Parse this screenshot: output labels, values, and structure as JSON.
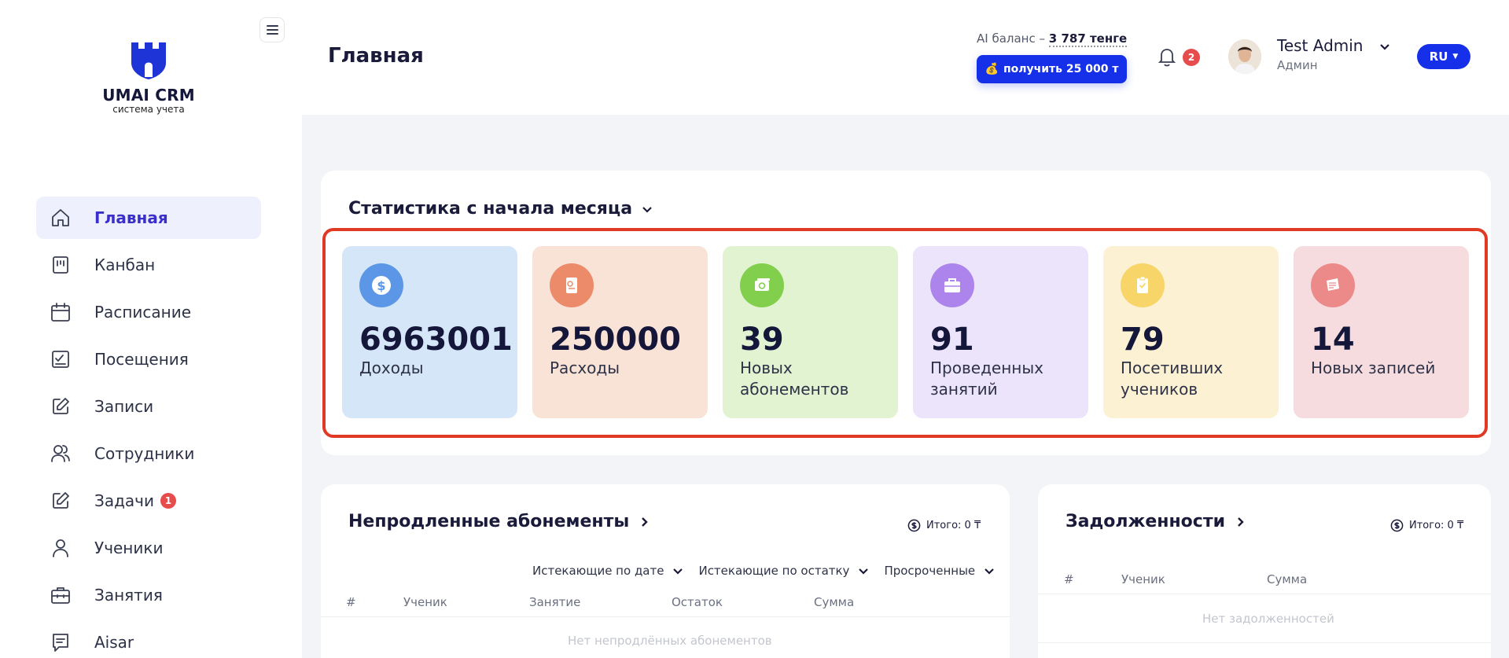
{
  "logo": {
    "name": "UMAI CRM",
    "subtitle": "система учета"
  },
  "sidebar": {
    "items": [
      {
        "label": "Главная",
        "icon": "home-icon",
        "active": true
      },
      {
        "label": "Канбан",
        "icon": "kanban-icon"
      },
      {
        "label": "Расписание",
        "icon": "calendar-icon"
      },
      {
        "label": "Посещения",
        "icon": "checklist-icon"
      },
      {
        "label": "Записи",
        "icon": "edit-icon"
      },
      {
        "label": "Сотрудники",
        "icon": "users-icon"
      },
      {
        "label": "Задачи",
        "icon": "edit-icon",
        "badge": "1"
      },
      {
        "label": "Ученики",
        "icon": "user-icon"
      },
      {
        "label": "Занятия",
        "icon": "briefcase-icon"
      },
      {
        "label": "Aisar",
        "icon": "chat-icon"
      }
    ]
  },
  "header": {
    "title": "Главная",
    "ai_balance_label": "AI баланс –",
    "ai_balance_value": "3 787 тенге",
    "get_button": "получить 25 000 т",
    "notifications_count": "2",
    "user_name": "Test Admin",
    "user_role": "Админ",
    "language": "RU"
  },
  "stats": {
    "title": "Статистика с начала месяца",
    "tiles": [
      {
        "value": "6963001",
        "label": "Доходы",
        "bg": "#d6e6f9",
        "icon_bg": "#5b97e6",
        "icon": "dollar-icon"
      },
      {
        "value": "250000",
        "label": "Расходы",
        "bg": "#f9e2d6",
        "icon_bg": "#ec8b69",
        "icon": "receipt-icon"
      },
      {
        "value": "39",
        "label": "Новых абонементов",
        "bg": "#e2f3d1",
        "icon_bg": "#82cf4d",
        "icon": "money-icon"
      },
      {
        "value": "91",
        "label": "Проведенных занятий",
        "bg": "#ece4fb",
        "icon_bg": "#ad84ec",
        "icon": "briefcase-icon"
      },
      {
        "value": "79",
        "label": "Посетивших учеников",
        "bg": "#fdf1d3",
        "icon_bg": "#f7d568",
        "icon": "clipboard-icon"
      },
      {
        "value": "14",
        "label": "Новых записей",
        "bg": "#f6dcdf",
        "icon_bg": "#ec8a8a",
        "icon": "notes-icon"
      }
    ]
  },
  "unrenewed": {
    "title": "Непродленные абонементы",
    "total": "Итого: 0 ₸",
    "filters": [
      "Истекающие по дате",
      "Истекающие по остатку",
      "Просроченные"
    ],
    "columns": [
      "#",
      "Ученик",
      "Занятие",
      "Остаток",
      "Сумма"
    ],
    "empty": "Нет непродлённых абонементов"
  },
  "debts": {
    "title": "Задолженности",
    "total": "Итого: 0 ₸",
    "columns": [
      "#",
      "Ученик",
      "Сумма"
    ],
    "empty": "Нет задолженностей"
  }
}
